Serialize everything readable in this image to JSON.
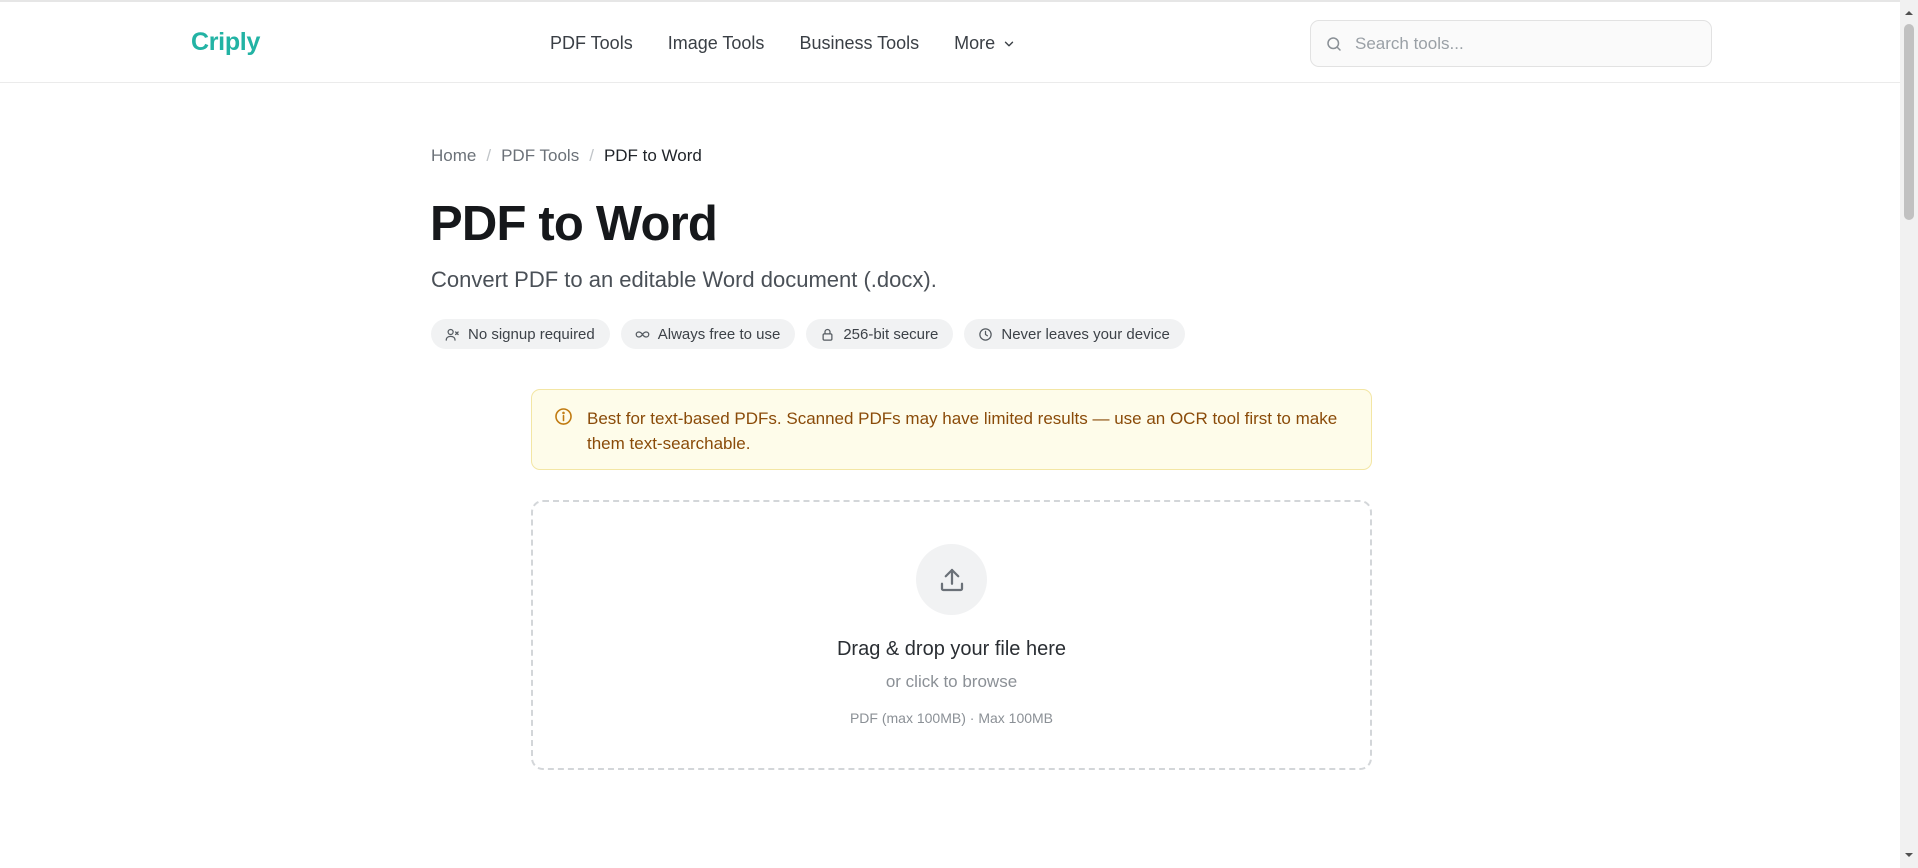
{
  "header": {
    "logo": "Criply",
    "nav": [
      {
        "label": "PDF Tools"
      },
      {
        "label": "Image Tools"
      },
      {
        "label": "Business Tools"
      },
      {
        "label": "More"
      }
    ],
    "search_placeholder": "Search tools..."
  },
  "breadcrumb": {
    "items": [
      "Home",
      "PDF Tools",
      "PDF to Word"
    ],
    "separator": "/"
  },
  "page": {
    "title": "PDF to Word",
    "subtitle": "Convert PDF to an editable Word document (.docx)."
  },
  "badges": [
    {
      "icon": "user-icon",
      "label": "No signup required"
    },
    {
      "icon": "infinity-icon",
      "label": "Always free to use"
    },
    {
      "icon": "lock-icon",
      "label": "256-bit secure"
    },
    {
      "icon": "clock-icon",
      "label": "Never leaves your device"
    }
  ],
  "notice": {
    "icon": "info-icon",
    "text": "Best for text-based PDFs. Scanned PDFs may have limited results — use an OCR tool first to make them text-searchable."
  },
  "dropzone": {
    "icon": "upload-icon",
    "title": "Drag & drop your file here",
    "subtitle": "or click to browse",
    "meta": "PDF (max 100MB) · Max 100MB"
  },
  "colors": {
    "brand": "#22b3a4",
    "notice_bg": "#fefcea",
    "notice_text": "#8a4b09"
  }
}
